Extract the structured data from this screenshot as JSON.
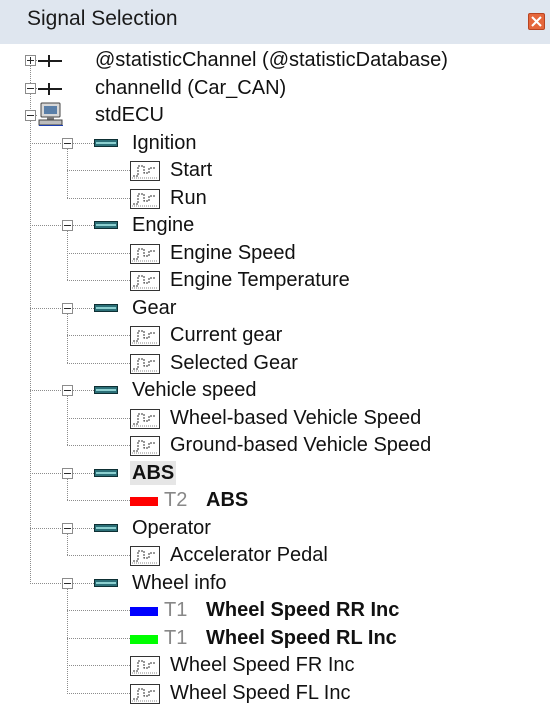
{
  "window": {
    "title": "Signal Selection"
  },
  "tree": [
    {
      "level": 0,
      "icon": "channel",
      "expander": "plus",
      "label": "@statisticChannel  (@statisticDatabase)"
    },
    {
      "level": 0,
      "icon": "channel",
      "expander": "minus",
      "label": "channelId  (Car_CAN)"
    },
    {
      "level": 1,
      "icon": "ecu",
      "expander": "minus",
      "label": "stdECU"
    },
    {
      "level": 2,
      "icon": "message",
      "expander": "minus",
      "label": "Ignition"
    },
    {
      "level": 3,
      "icon": "signal",
      "label": "Start"
    },
    {
      "level": 3,
      "icon": "signal",
      "label": "Run"
    },
    {
      "level": 2,
      "icon": "message",
      "expander": "minus",
      "label": "Engine"
    },
    {
      "level": 3,
      "icon": "signal",
      "label": "Engine Speed"
    },
    {
      "level": 3,
      "icon": "signal",
      "label": "Engine Temperature"
    },
    {
      "level": 2,
      "icon": "message",
      "expander": "minus",
      "label": "Gear"
    },
    {
      "level": 3,
      "icon": "signal",
      "label": "Current gear"
    },
    {
      "level": 3,
      "icon": "signal",
      "label": "Selected Gear"
    },
    {
      "level": 2,
      "icon": "message",
      "expander": "minus",
      "label": "Vehicle speed"
    },
    {
      "level": 3,
      "icon": "signal",
      "label": "Wheel-based Vehicle Speed"
    },
    {
      "level": 3,
      "icon": "signal",
      "label": "Ground-based Vehicle Speed"
    },
    {
      "level": 2,
      "icon": "message",
      "expander": "minus",
      "label": "ABS",
      "bold": true,
      "highlight": true
    },
    {
      "level": 3,
      "icon": "color",
      "color": "#ff0000",
      "tmark": "T2",
      "label": "ABS",
      "bold": true
    },
    {
      "level": 2,
      "icon": "message",
      "expander": "minus",
      "label": "Operator"
    },
    {
      "level": 3,
      "icon": "signal",
      "label": "Accelerator Pedal"
    },
    {
      "level": 2,
      "icon": "message",
      "expander": "minus",
      "label": "Wheel info"
    },
    {
      "level": 3,
      "icon": "color",
      "color": "#0000ff",
      "tmark": "T1",
      "label": "Wheel Speed RR Inc",
      "bold": true
    },
    {
      "level": 3,
      "icon": "color",
      "color": "#00ff00",
      "tmark": "T1",
      "label": "Wheel Speed RL Inc",
      "bold": true
    },
    {
      "level": 3,
      "icon": "signal",
      "label": "Wheel Speed FR Inc"
    },
    {
      "level": 3,
      "icon": "signal",
      "label": "Wheel Speed FL Inc"
    }
  ]
}
